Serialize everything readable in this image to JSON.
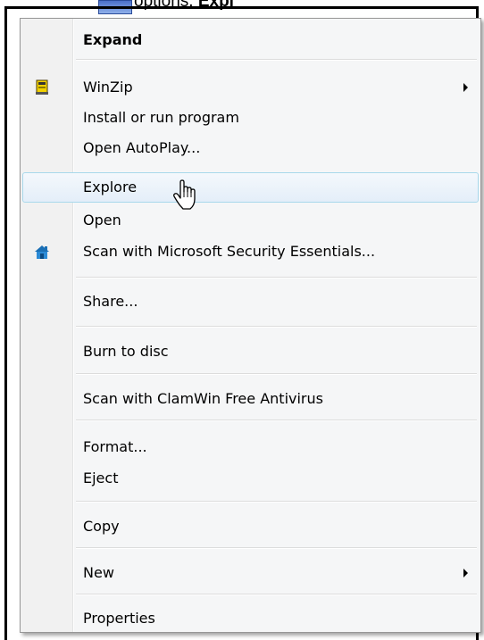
{
  "background": {
    "title_prefix": "options, ",
    "title_bold": "Expl"
  },
  "menu": {
    "items": [
      {
        "label": "Expand",
        "bold": true
      },
      {
        "label": "WinZip",
        "icon": "winzip-icon",
        "submenu": true
      },
      {
        "label": "Install or run program"
      },
      {
        "label": "Open AutoPlay..."
      },
      {
        "label": "Explore",
        "highlighted": true
      },
      {
        "label": "Open"
      },
      {
        "label": "Scan with Microsoft Security Essentials...",
        "icon": "microsoft-security-essentials-icon"
      },
      {
        "label": "Share..."
      },
      {
        "label": "Burn to disc"
      },
      {
        "label": "Scan with ClamWin Free Antivirus"
      },
      {
        "label": "Format..."
      },
      {
        "label": "Eject"
      },
      {
        "label": "Copy"
      },
      {
        "label": "New",
        "submenu": true
      },
      {
        "label": "Properties"
      }
    ]
  },
  "colors": {
    "menu_bg": "#f5f6f7",
    "highlight_border": "#a8d8eb",
    "highlight_bg": "#e4eef9"
  }
}
